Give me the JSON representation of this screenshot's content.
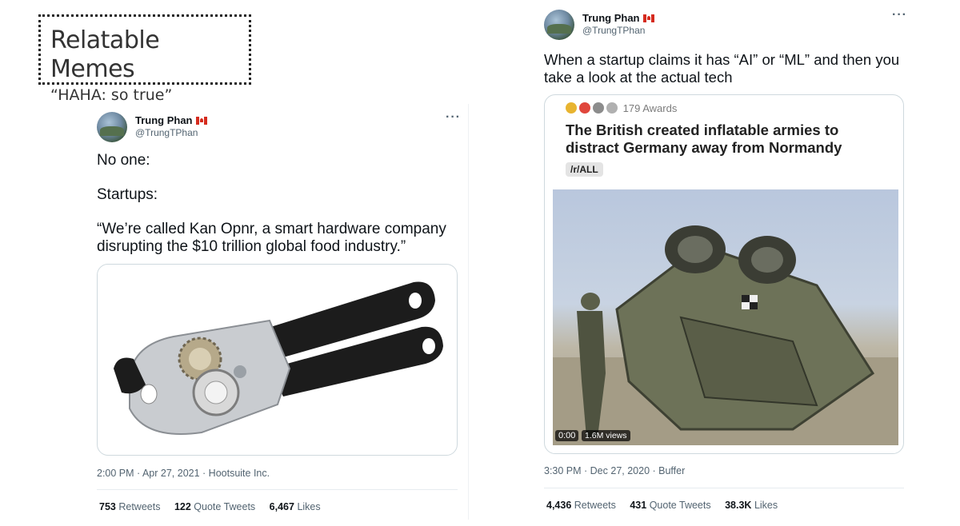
{
  "header": {
    "title": "Relatable Memes",
    "subtitle": "“HAHA: so true”"
  },
  "left_tweet": {
    "author_name": "Trung Phan",
    "author_handle": "@TrungTPhan",
    "more_icon": "ellipsis-icon",
    "lines": [
      "No one:",
      "Startups:",
      "“We’re called Kan Opnr, a smart hardware company",
      "disrupting  the $10 trillion global food industry.”"
    ],
    "media_icon": "can-opener-image",
    "timestamp": "2:00 PM · Apr 27, 2021 · Hootsuite Inc.",
    "retweets_value": "753",
    "retweets_label": "Retweets",
    "quotes_value": "122",
    "quotes_label": "Quote Tweets",
    "likes_value": "6,467",
    "likes_label": "Likes"
  },
  "right_tweet": {
    "author_name": "Trung Phan",
    "author_handle": "@TrungTPhan",
    "more_icon": "ellipsis-icon",
    "line1": "When a startup claims it has “AI” or “ML” and then you",
    "line2": "take a look at the actual tech",
    "card": {
      "awards": "179 Awards",
      "title": "The British created inflatable armies to distract Germany away from Normandy",
      "subreddit": "/r/ALL",
      "video_time": "0:00",
      "video_views": "1.6M views",
      "video_icon": "tipped-over-jeep-image"
    },
    "timestamp": "3:30 PM · Dec 27, 2020 · Buffer",
    "retweets_value": "4,436",
    "retweets_label": "Retweets",
    "quotes_value": "431",
    "quotes_label": "Quote Tweets",
    "likes_value": "38.3K",
    "likes_label": "Likes"
  },
  "colors": {
    "text": "#0f1419",
    "secondary": "#536471",
    "border": "#cfd9de",
    "canada_red": "#d52b1e"
  }
}
